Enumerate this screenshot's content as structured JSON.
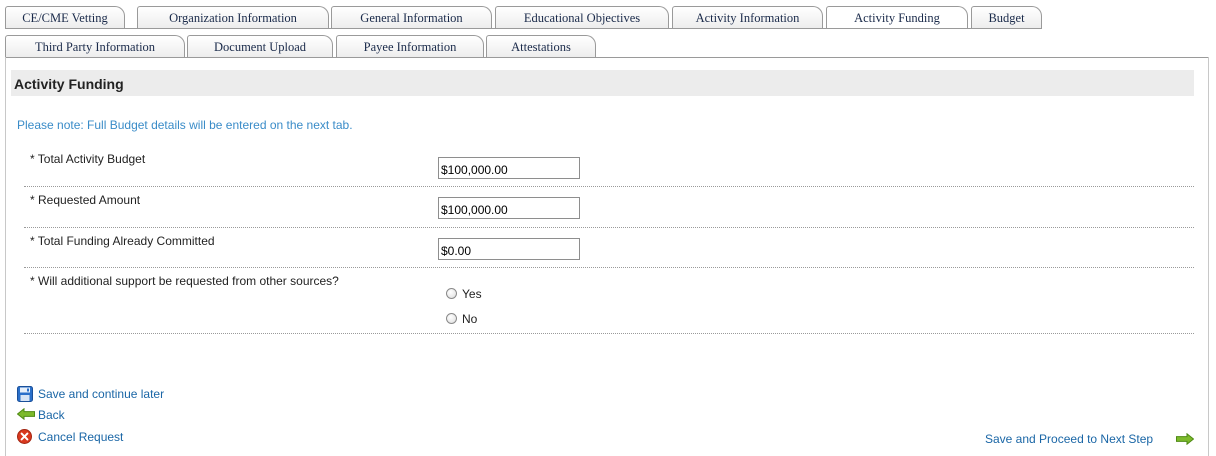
{
  "tabs": {
    "row1": [
      {
        "label": "CE/CME Vetting"
      },
      {
        "label": "Organization Information"
      },
      {
        "label": "General Information"
      },
      {
        "label": "Educational Objectives"
      },
      {
        "label": "Activity Information"
      },
      {
        "label": "Activity Funding",
        "active": true
      },
      {
        "label": "Budget"
      }
    ],
    "row2": [
      {
        "label": "Third Party Information"
      },
      {
        "label": "Document Upload"
      },
      {
        "label": "Payee Information"
      },
      {
        "label": "Attestations"
      }
    ]
  },
  "section": {
    "title": "Activity Funding",
    "note": "Please note: Full Budget details will be entered on the next tab."
  },
  "fields": {
    "total_budget": {
      "label": "* Total Activity Budget",
      "value": "$100,000.00"
    },
    "requested_amount": {
      "label": "* Requested Amount",
      "value": "$100,000.00"
    },
    "already_committed": {
      "label": "* Total Funding Already Committed",
      "value": "$0.00"
    },
    "additional_support": {
      "label": "* Will additional support be requested from other sources?",
      "options": [
        "Yes",
        "No"
      ],
      "selected": null
    }
  },
  "actions": {
    "save_later": "Save and continue later",
    "back": "Back",
    "cancel": "Cancel Request",
    "next": "Save and Proceed to Next Step"
  },
  "colors": {
    "link": "#1a66a6",
    "note": "#3a8cc8",
    "header_bg": "#ececec",
    "back_arrow": "#7dba2b",
    "cancel_icon": "#d9381e",
    "save_icon": "#2a6fc9"
  }
}
